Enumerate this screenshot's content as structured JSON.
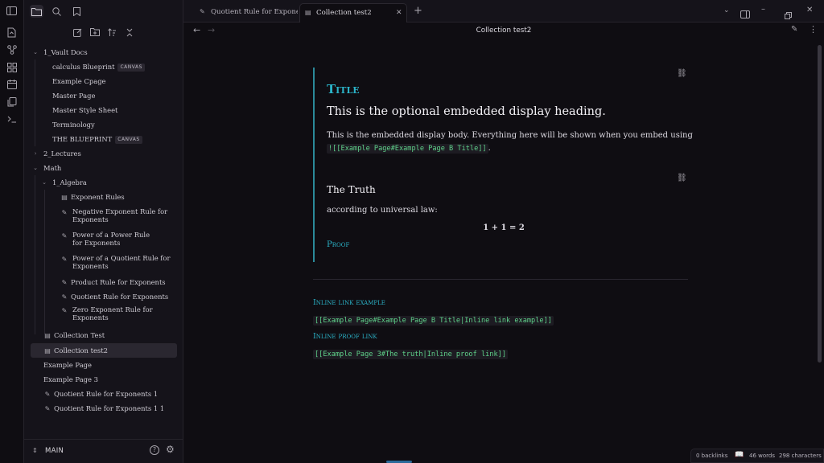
{
  "ribbon": {
    "icons": [
      "sidebar-toggle-icon",
      "new-note-icon",
      "graph-icon",
      "canvas-icon",
      "calendar-icon",
      "copy-icon",
      "terminal-icon"
    ]
  },
  "sidebar": {
    "tree": [
      {
        "label": "1_Vault Docs",
        "type": "folder-open"
      },
      {
        "label": "calculus Blueprint",
        "badge": "CANVAS"
      },
      {
        "label": "Example Cpage"
      },
      {
        "label": "Master Page"
      },
      {
        "label": "Master Style Sheet"
      },
      {
        "label": "Terminology"
      },
      {
        "label": "THE BLUEPRINT",
        "badge": "CANVAS"
      },
      {
        "label": "2_Lectures",
        "type": "folder-closed"
      },
      {
        "label": "Math",
        "type": "folder-open"
      },
      {
        "label": "1_Algebra",
        "type": "folder-open"
      },
      {
        "label": "Exponent Rules"
      },
      {
        "label": "Negative Exponent Rule for Exponents"
      },
      {
        "label": "Power of a Power Rule for Exponents"
      },
      {
        "label": "Power of a Quotient Rule for Exponents"
      },
      {
        "label": "Product Rule for Exponents"
      },
      {
        "label": "Quotient Rule for Exponents"
      },
      {
        "label": "Zero Exponent Rule for Exponents"
      },
      {
        "label": "Collection Test"
      },
      {
        "label": "Collection test2"
      },
      {
        "label": "Example Page"
      },
      {
        "label": "Example Page 3"
      },
      {
        "label": "Quotient Rule for Exponents 1"
      },
      {
        "label": "Quotient Rule for Exponents 1 1"
      }
    ],
    "vault_name": "MAIN"
  },
  "tabs": [
    {
      "label": "Quotient Rule for Expone..."
    },
    {
      "label": "Collection test2"
    }
  ],
  "view": {
    "title": "Collection test2"
  },
  "content": {
    "callout1": {
      "title": "Title",
      "heading": "This is the optional embedded display heading.",
      "body": "This is the embedded display body. Everything here will be shown when you embed using",
      "code": "![[Example Page#Example Page B Title]]",
      "after_code": "."
    },
    "callout2": {
      "title": "The Truth",
      "body": "according to universal law:",
      "math": "1 + 1 = 2",
      "proof": "Proof"
    },
    "inline_link_label": "Inline link example",
    "inline_link_code": "[[Example Page#Example Page B Title|Inline link example]]",
    "inline_proof_label": "Inline proof link",
    "inline_proof_code": "[[Example Page 3#The truth|Inline proof link]]"
  },
  "status": {
    "backlinks": "0 backlinks",
    "words": "46 words",
    "characters": "298 characters"
  },
  "colors": {
    "accent": "#2bb3c8",
    "code_text": "#5fd18a",
    "background": "#0f0d12",
    "sidebar_bg": "#15131a"
  }
}
